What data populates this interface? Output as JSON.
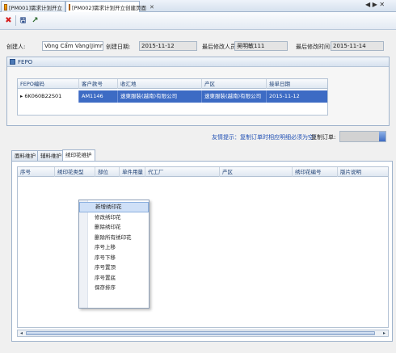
{
  "tabs": [
    {
      "label": "[PM001]需求计划开立"
    },
    {
      "label": "[PM002]需求计划开立创建页面"
    }
  ],
  "window_controls": {
    "nav": "◀ ▶ ✕"
  },
  "toolbar": {
    "delete_glyph": "✖",
    "save_glyph": "🖫",
    "export_glyph": "↗"
  },
  "info": {
    "creator_label": "创建人:",
    "creator_value": "Vòng Cẩm Vàng(Jimmy V",
    "create_date_label": "创建日期:",
    "create_date_value": "2015-11-12",
    "last_modifier_label": "最后修改人员:",
    "last_modifier_value": "吴明敏111",
    "last_modify_time_label": "最后修改时间:",
    "last_modify_time_value": "2015-11-14"
  },
  "fepo_panel": {
    "title": "FEPO",
    "columns": [
      "FEPO编码",
      "客户款号",
      "收汇地",
      "产区",
      "接单日期"
    ],
    "rows": [
      {
        "indicator": "▸",
        "fepo_code": "6K060B22S01",
        "style_no": "AM1146",
        "collection": "速東服裝(越南)有限公司",
        "region": "速東服裝(越南)有限公司",
        "order_date": "2015-11-12"
      }
    ]
  },
  "hint": {
    "text": "友情提示：复制订单时相应明细必须为空！",
    "copy_order_label": "复制订单:",
    "copy_order_value": ""
  },
  "detail_tabs": [
    "面料维护",
    "辅料维护",
    "绣印花维护"
  ],
  "detail_grid": {
    "columns": [
      "序号",
      "绣印花类型",
      "部位",
      "单件用量",
      "代工厂",
      "产区",
      "绣印花编号",
      "版片说明"
    ]
  },
  "context_menu": {
    "items": [
      "新增绣印花",
      "修改绣印花",
      "删除绣印花",
      "删除所有绣印花",
      "序号上移",
      "序号下移",
      "序号置顶",
      "序号置底",
      "保存排序"
    ]
  },
  "colors": {
    "selection": "#3d6bc4",
    "hint": "#1f4fb4",
    "delete": "#d62020"
  }
}
